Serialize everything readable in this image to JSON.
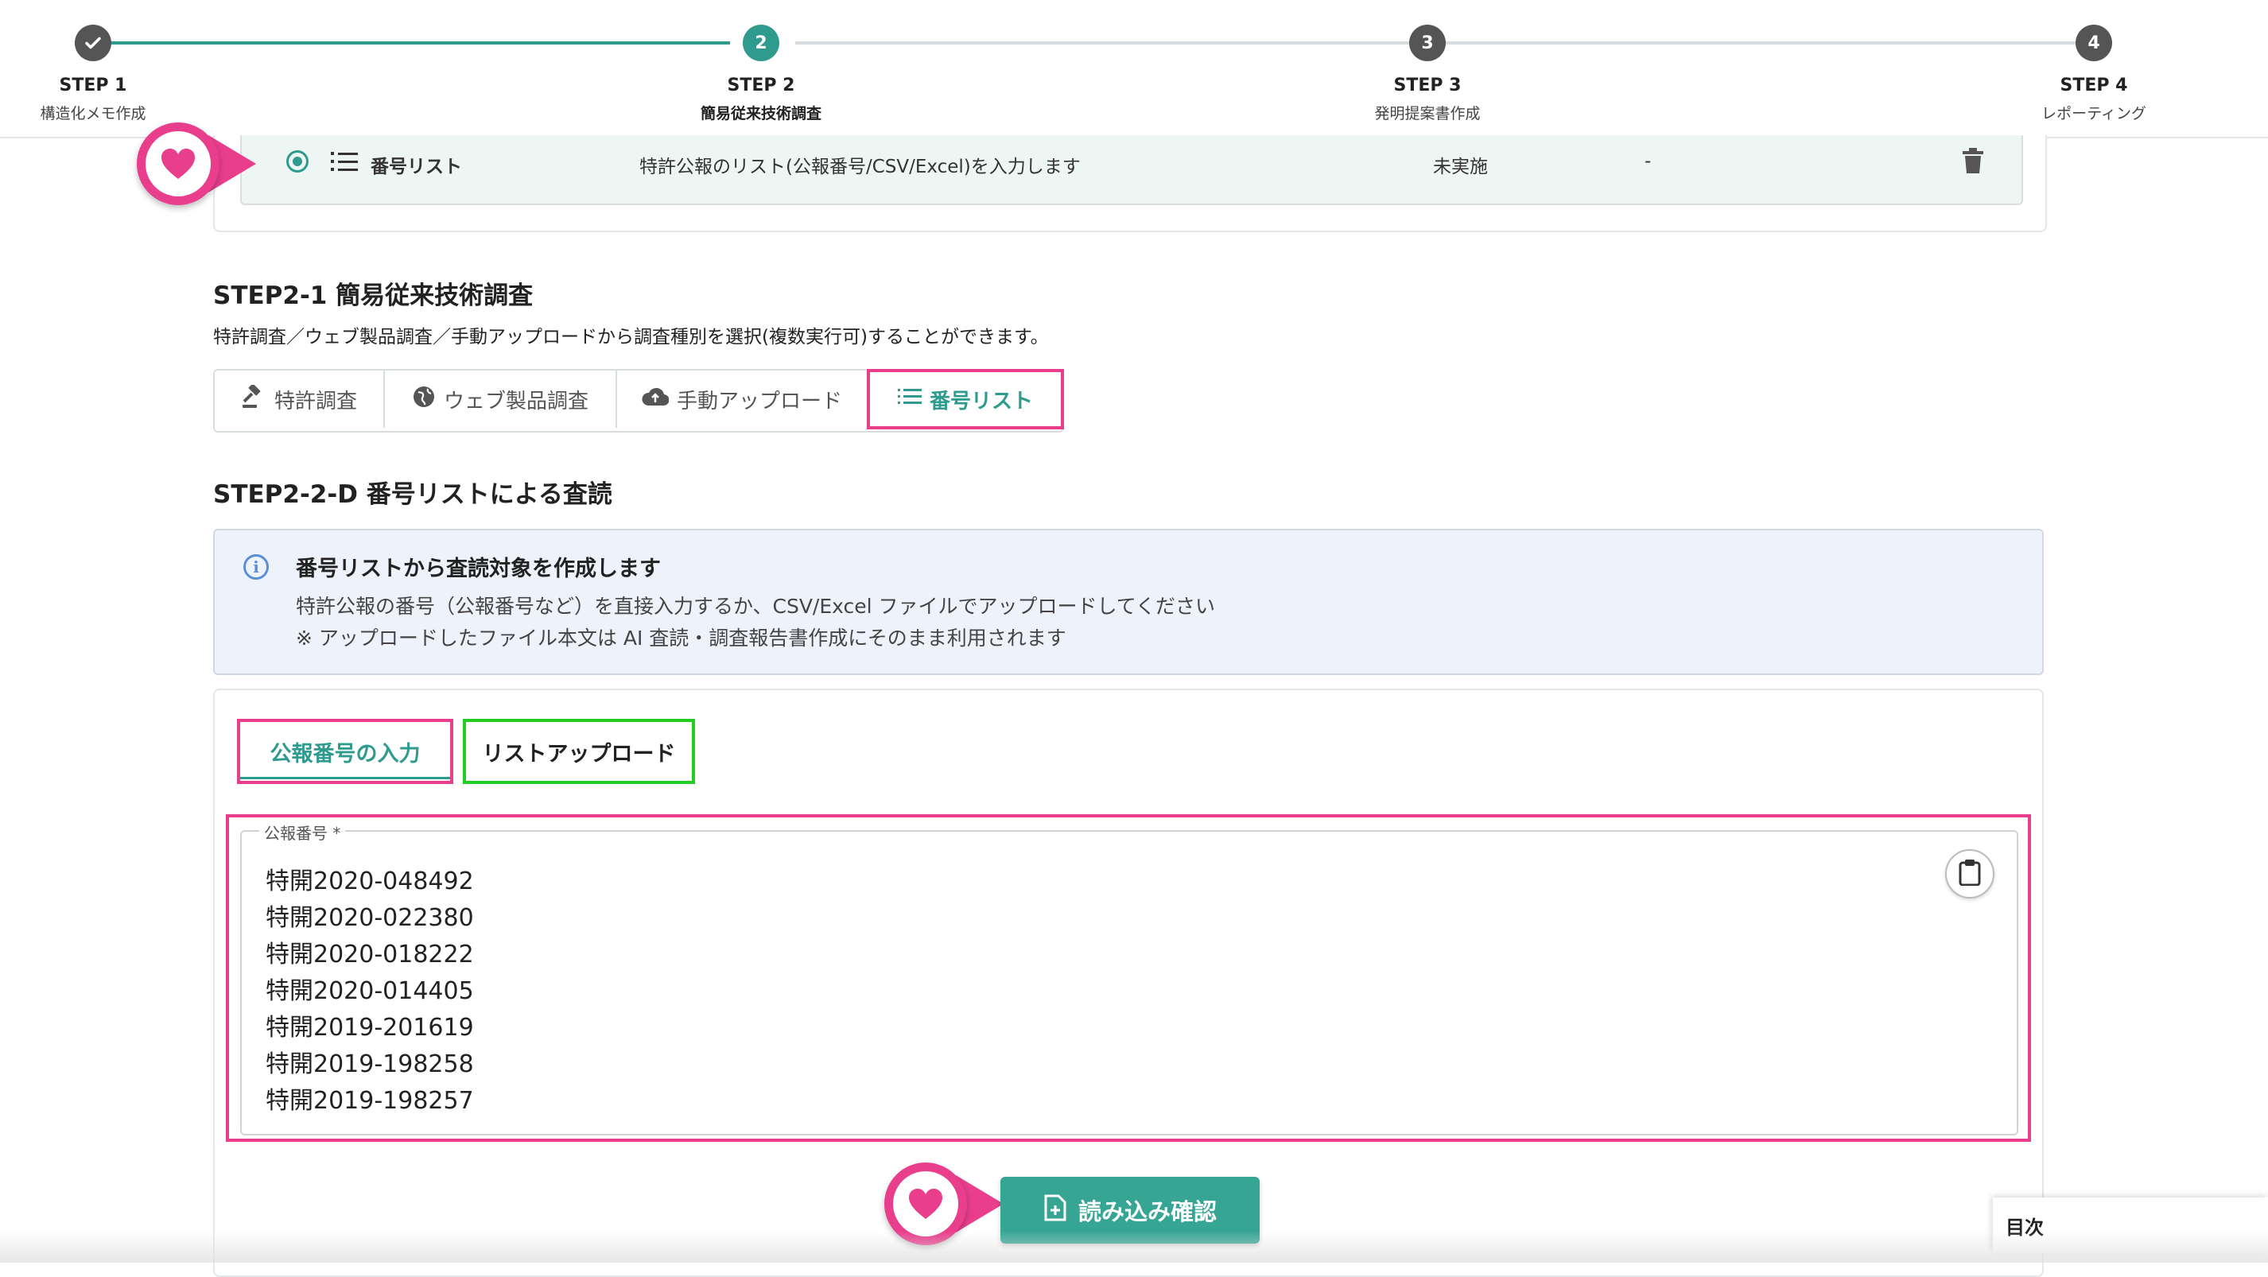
{
  "colors": {
    "accent": "#2e9b8e",
    "highlight_pink": "#e83e8c",
    "highlight_green": "#22cc22",
    "step_inactive": "#555555"
  },
  "stepper": {
    "steps": [
      {
        "number": "✓",
        "title": "STEP 1",
        "subtitle": "構造化メモ作成",
        "state": "done"
      },
      {
        "number": "2",
        "title": "STEP 2",
        "subtitle": "簡易従来技術調査",
        "state": "active"
      },
      {
        "number": "3",
        "title": "STEP 3",
        "subtitle": "発明提案書作成",
        "state": "pending"
      },
      {
        "number": "4",
        "title": "STEP 4",
        "subtitle": "レポーティング",
        "state": "pending"
      }
    ]
  },
  "list_row": {
    "name": "番号リスト",
    "description": "特許公報のリスト(公報番号/CSV/Excel)を入力します",
    "status": "未実施",
    "extra": "-"
  },
  "section_21": {
    "title": "STEP2-1 簡易従来技術調査",
    "description": "特許調査／ウェブ製品調査／手動アップロードから調査種別を選択(複数実行可)することができます。"
  },
  "tabs": [
    {
      "label": "特許調査",
      "icon": "gavel-icon"
    },
    {
      "label": "ウェブ製品調査",
      "icon": "globe-icon"
    },
    {
      "label": "手動アップロード",
      "icon": "cloud-upload-icon"
    },
    {
      "label": "番号リスト",
      "icon": "list-icon",
      "active": true
    }
  ],
  "section_22": {
    "title": "STEP2-2-D 番号リストによる査読"
  },
  "info": {
    "title": "番号リストから査読対象を作成します",
    "line1": "特許公報の番号（公報番号など）を直接入力するか、CSV/Excel ファイルでアップロードしてください",
    "line2": "※ アップロードしたファイル本文は AI 査読・調査報告書作成にそのまま利用されます"
  },
  "subtabs": {
    "manual": "公報番号の入力",
    "upload": "リストアップロード"
  },
  "field": {
    "label": "公報番号 *",
    "values": [
      "特開2020-048492",
      "特開2020-022380",
      "特開2020-018222",
      "特開2020-014405",
      "特開2019-201619",
      "特開2019-198258",
      "特開2019-198257"
    ]
  },
  "confirm_button": {
    "label": "読み込み確認"
  },
  "toc": {
    "label": "目次"
  }
}
